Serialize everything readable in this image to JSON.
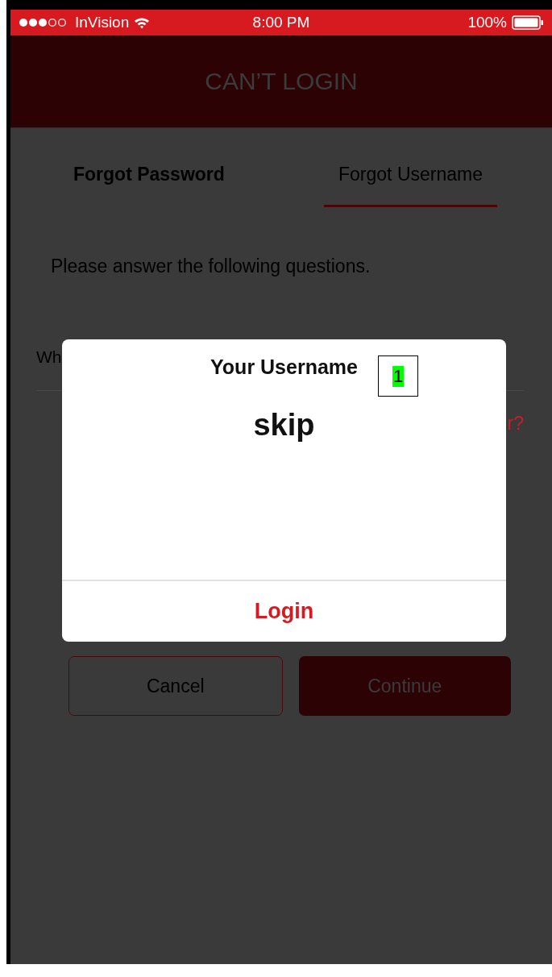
{
  "status_bar": {
    "carrier": "InVision",
    "time": "8:00 PM",
    "battery": "100%"
  },
  "header": {
    "title": "CAN’T LOGIN"
  },
  "tabs": [
    {
      "label": "Forgot Password",
      "selected": false
    },
    {
      "label": "Forgot Username",
      "selected": true
    }
  ],
  "instructions": "Please answer the following questions.",
  "question": {
    "label": "Wh",
    "link": "r?"
  },
  "buttons": [
    {
      "label": "Cancel",
      "kind": "outline"
    },
    {
      "label": "Continue",
      "kind": "filled"
    }
  ],
  "dialog": {
    "title": "Your Username",
    "annotation_marker": "1",
    "username": "skip",
    "action": "Login"
  }
}
